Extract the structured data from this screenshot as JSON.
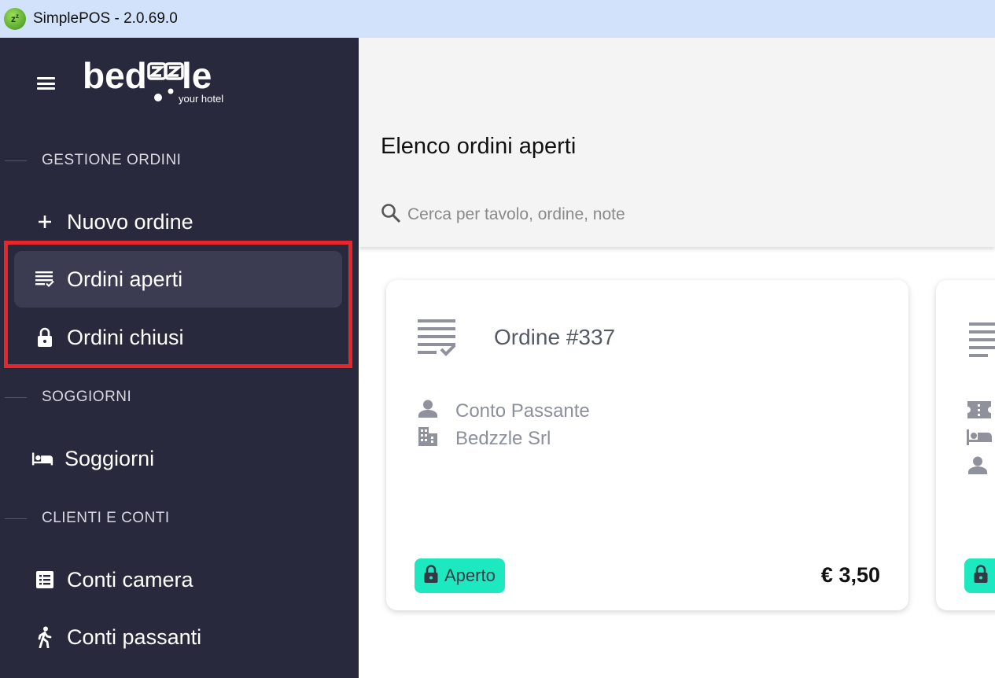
{
  "window": {
    "title": "SimplePOS - 2.0.69.0"
  },
  "sidebar": {
    "logo_text": "bedzzle",
    "logo_tagline": "your hotel",
    "sections": [
      {
        "label": "GESTIONE ORDINI"
      },
      {
        "label": "SOGGIORNI"
      },
      {
        "label": "CLIENTI E CONTI"
      }
    ],
    "items": [
      {
        "label": "Nuovo ordine",
        "icon": "plus-icon"
      },
      {
        "label": "Ordini aperti",
        "icon": "list-check-icon",
        "active": true
      },
      {
        "label": "Ordini chiusi",
        "icon": "lock-icon"
      },
      {
        "label": "Soggiorni",
        "icon": "bed-icon"
      },
      {
        "label": "Conti camera",
        "icon": "list-box-icon"
      },
      {
        "label": "Conti passanti",
        "icon": "walking-icon"
      }
    ]
  },
  "main": {
    "title": "Elenco ordini aperti",
    "search": {
      "placeholder": "Cerca per tavolo, ordine, note"
    },
    "orders": [
      {
        "title": "Ordine #337",
        "customer": "Conto Passante",
        "company": "Bedzzle Srl",
        "status": "Aperto",
        "total": "€ 3,50"
      }
    ]
  },
  "colors": {
    "sidebar_bg": "#29293e",
    "active_item_bg": "#3b3b52",
    "status_open": "#1de9c1",
    "highlight": "#e8262a",
    "titlebar_bg": "#d3e2fb"
  }
}
